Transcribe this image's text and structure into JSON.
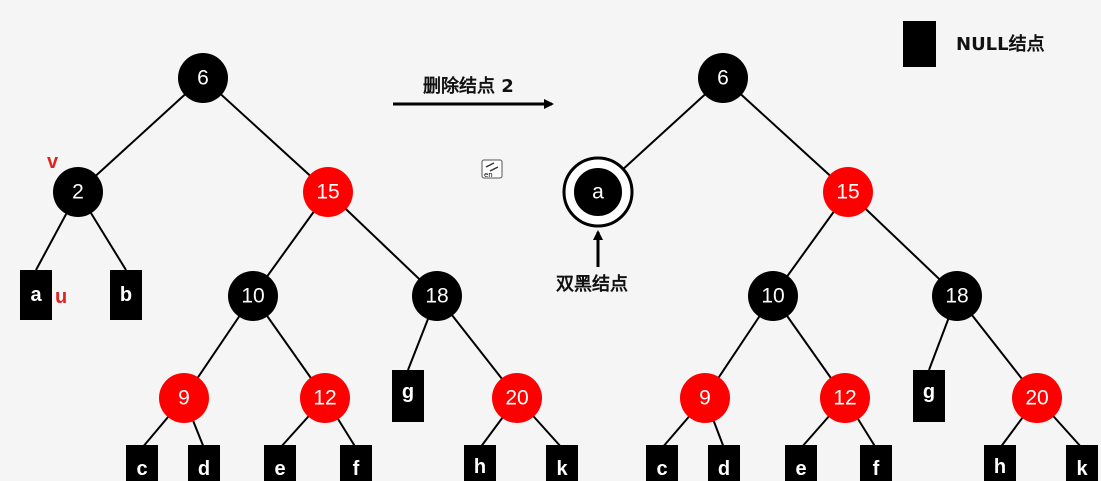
{
  "colors": {
    "black_node": "#000000",
    "red_node": "#ff0000",
    "edge": "#000000",
    "annotation": "#e02424",
    "background": "#f5f5f5"
  },
  "legend": {
    "label": "NULL结点"
  },
  "operation": {
    "label": "删除结点 2"
  },
  "double_black": {
    "label": "双黑结点",
    "value": "a"
  },
  "annotations": {
    "v": "v",
    "u": "u"
  },
  "translate_icon": {
    "icon": "translate-icon",
    "text": "en"
  },
  "left_tree": {
    "nodes": {
      "n6": "6",
      "n2": "2",
      "n15": "15",
      "n10": "10",
      "n18": "18",
      "n9": "9",
      "n12": "12",
      "n20": "20"
    },
    "leaves": {
      "a": "a",
      "b": "b",
      "g": "g",
      "c": "c",
      "d": "d",
      "e": "e",
      "f": "f",
      "h": "h",
      "k": "k"
    }
  },
  "right_tree": {
    "nodes": {
      "n6": "6",
      "n15": "15",
      "n10": "10",
      "n18": "18",
      "n9": "9",
      "n12": "12",
      "n20": "20"
    },
    "leaves": {
      "g": "g",
      "c": "c",
      "d": "d",
      "e": "e",
      "f": "f",
      "h": "h",
      "k": "k"
    }
  }
}
